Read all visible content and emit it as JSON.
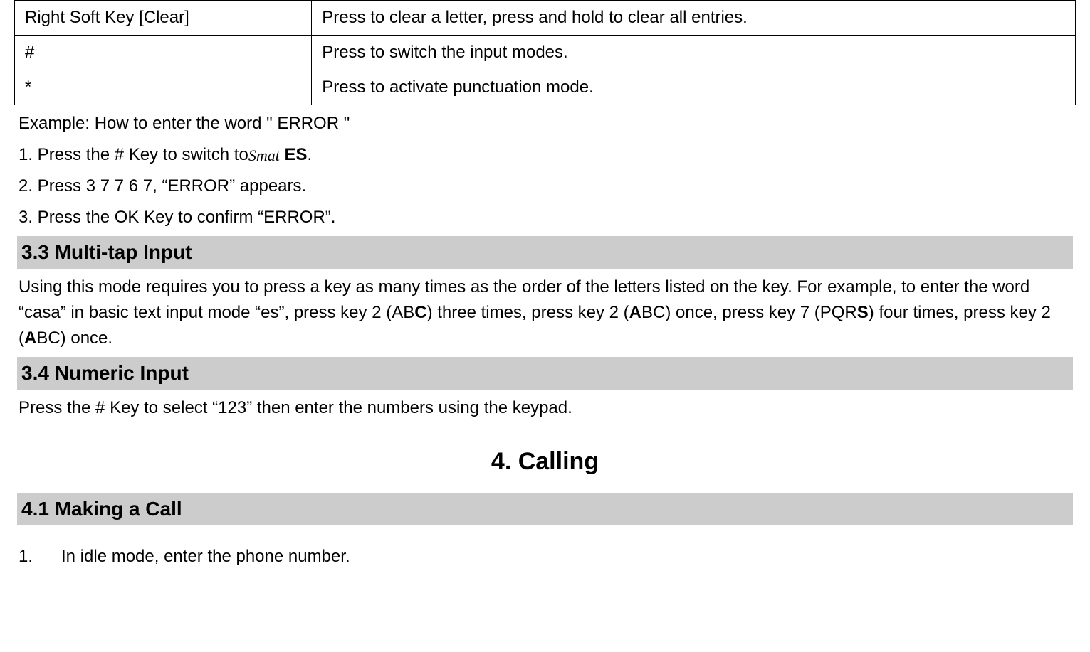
{
  "table": {
    "rows": [
      {
        "key": "Right Soft Key [Clear]",
        "desc": "Press to clear a letter, press and hold to clear all entries."
      },
      {
        "key": "#",
        "desc": "Press to switch the input modes."
      },
      {
        "key": "*",
        "desc": "Press to activate punctuation mode."
      }
    ]
  },
  "example": {
    "intro": "Example: How to enter the word \" ERROR \"",
    "step1_pre": "1. Press the # Key to switch to",
    "step1_icon": "Smat",
    "step1_post": " ES",
    "step1_post_plain": ".",
    "step2": "2. Press 3 7 7 6 7, “ERROR” appears.",
    "step3": "3. Press the OK Key to confirm “ERROR”."
  },
  "section33": {
    "title": "3.3  Multi-tap Input",
    "para_pre": "Using this mode requires you to press a key as many times as the order of the letters listed on the key. For example, to enter the word “casa” in basic text input mode “es”, press key 2 (AB",
    "C": "C",
    "para_mid1": ") three times, press key 2 (",
    "A1": "A",
    "para_mid2": "BC) once, press key 7 (PQR",
    "S": "S",
    "para_mid3": ") four times, press key 2 (",
    "A2": "A",
    "para_post": "BC) once."
  },
  "section34": {
    "title": "3.4  Numeric Input",
    "para": "Press the # Key to select “123” then enter the numbers using the keypad."
  },
  "chapter4": {
    "title": "4.   Calling"
  },
  "section41": {
    "title": "4.1  Making a Call",
    "item1_num": "1.",
    "item1_txt": "In idle mode, enter the phone number."
  }
}
